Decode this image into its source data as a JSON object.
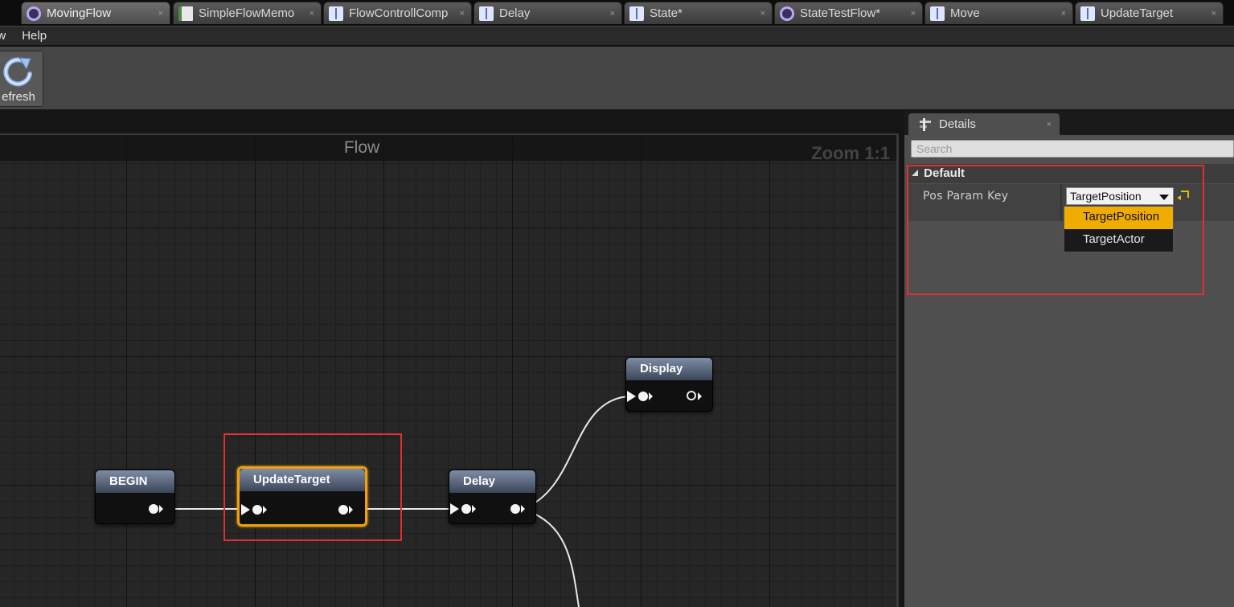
{
  "tabs": [
    {
      "label": "MovingFlow",
      "icon": "flow-ring-icon",
      "active": true
    },
    {
      "label": "SimpleFlowMemo",
      "icon": "memo-icon"
    },
    {
      "label": "FlowControllComp",
      "icon": "book-icon"
    },
    {
      "label": "Delay",
      "icon": "book-icon"
    },
    {
      "label": "State*",
      "icon": "book-icon"
    },
    {
      "label": "StateTestFlow*",
      "icon": "flow-ring-icon"
    },
    {
      "label": "Move",
      "icon": "book-icon"
    },
    {
      "label": "UpdateTarget",
      "icon": "book-icon"
    }
  ],
  "tab_close_glyph": "×",
  "menu": {
    "items": [
      "ow",
      "Help"
    ]
  },
  "toolbar": {
    "refresh_label": "efresh",
    "refresh_icon": "refresh-icon"
  },
  "graph": {
    "title": "Flow",
    "zoom": "Zoom 1:1",
    "nodes": [
      {
        "id": "begin",
        "title": "BEGIN"
      },
      {
        "id": "update_target",
        "title": "UpdateTarget",
        "selected": true
      },
      {
        "id": "delay",
        "title": "Delay"
      },
      {
        "id": "display",
        "title": "Display"
      }
    ]
  },
  "details": {
    "tab_label": "Details",
    "close_glyph": "×",
    "search_placeholder": "Search",
    "category": "Default",
    "property_name": "Pos Param Key",
    "combo_value": "TargetPosition",
    "dropdown_options": [
      "TargetPosition",
      "TargetActor"
    ],
    "highlighted_option": "TargetPosition"
  },
  "colors": {
    "selection_border": "#f0a010",
    "annotation_red": "#e03030",
    "dropdown_highlight": "#f0ac00",
    "node_header": "#5a6a84"
  }
}
